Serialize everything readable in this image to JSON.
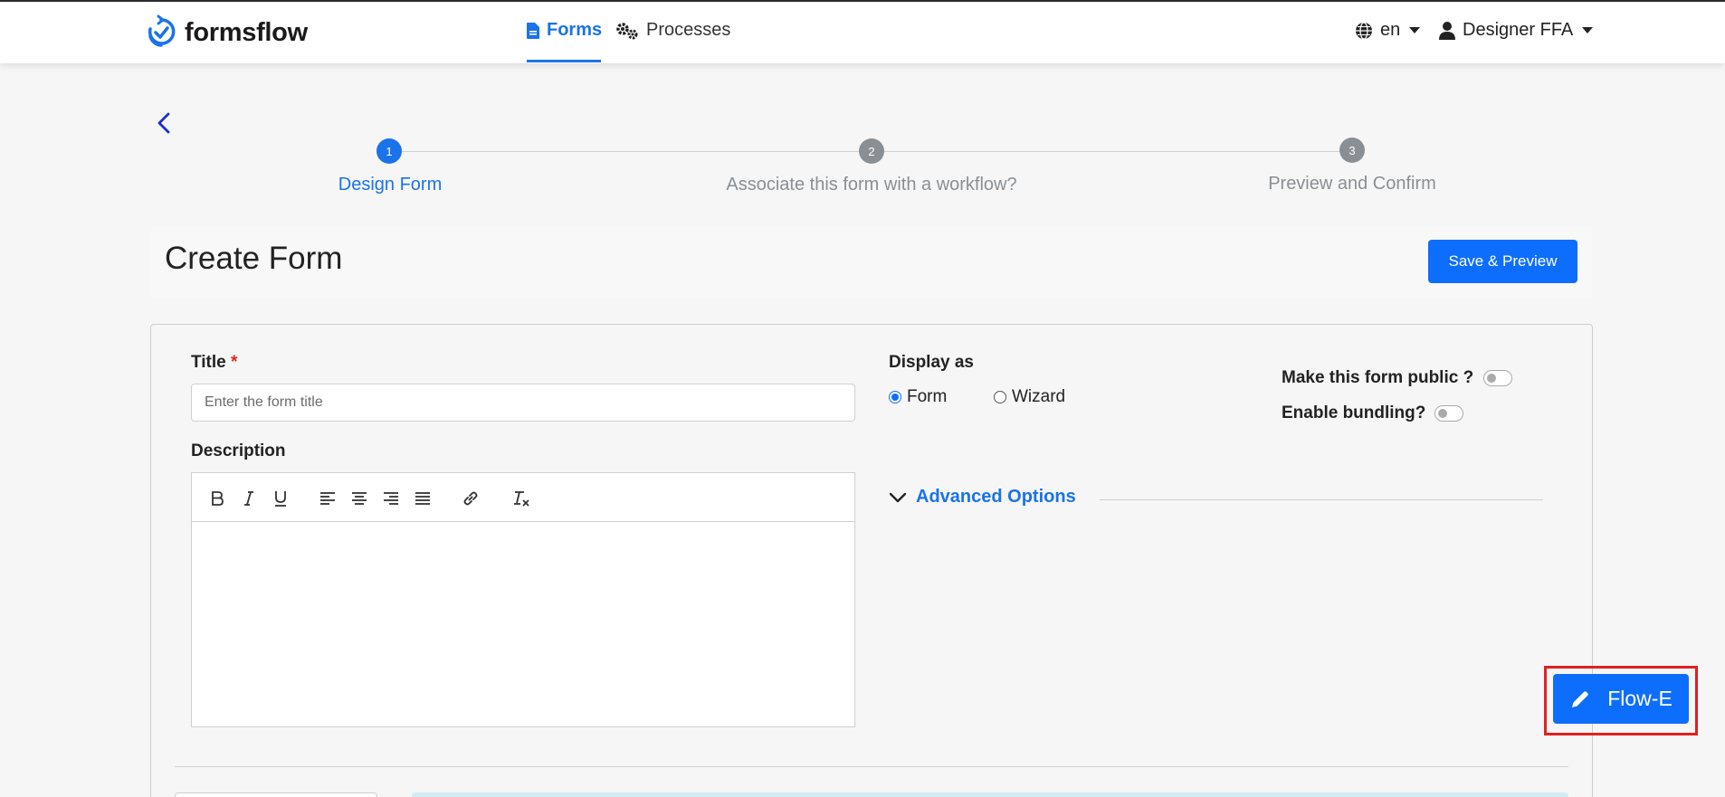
{
  "navbar": {
    "brand": "formsflow",
    "forms_label": "Forms",
    "processes_label": "Processes",
    "language": "en",
    "user": "Designer FFA"
  },
  "stepper": {
    "steps": [
      {
        "number": "1",
        "label": "Design Form",
        "state": "active"
      },
      {
        "number": "2",
        "label": "Associate this form with a workflow?",
        "state": "inactive"
      },
      {
        "number": "3",
        "label": "Preview and Confirm",
        "state": "inactive"
      }
    ]
  },
  "header": {
    "title": "Create Form",
    "save_label": "Save & Preview"
  },
  "form": {
    "title_label": "Title",
    "required_mark": "*",
    "title_value": "",
    "title_placeholder": "Enter the form title",
    "description_label": "Description",
    "display_as_label": "Display as",
    "display_options": [
      {
        "label": "Form",
        "selected": true
      },
      {
        "label": "Wizard",
        "selected": false
      }
    ],
    "public_label": "Make this form public ?",
    "public_on": false,
    "bundling_label": "Enable bundling?",
    "bundling_on": false,
    "advanced_label": "Advanced Options"
  },
  "flowe": {
    "label": "Flow-E"
  },
  "colors": {
    "primary": "#0d6efd",
    "link": "#1a73e8",
    "inactive_step": "#8a8f94",
    "highlight": "#e02020"
  }
}
